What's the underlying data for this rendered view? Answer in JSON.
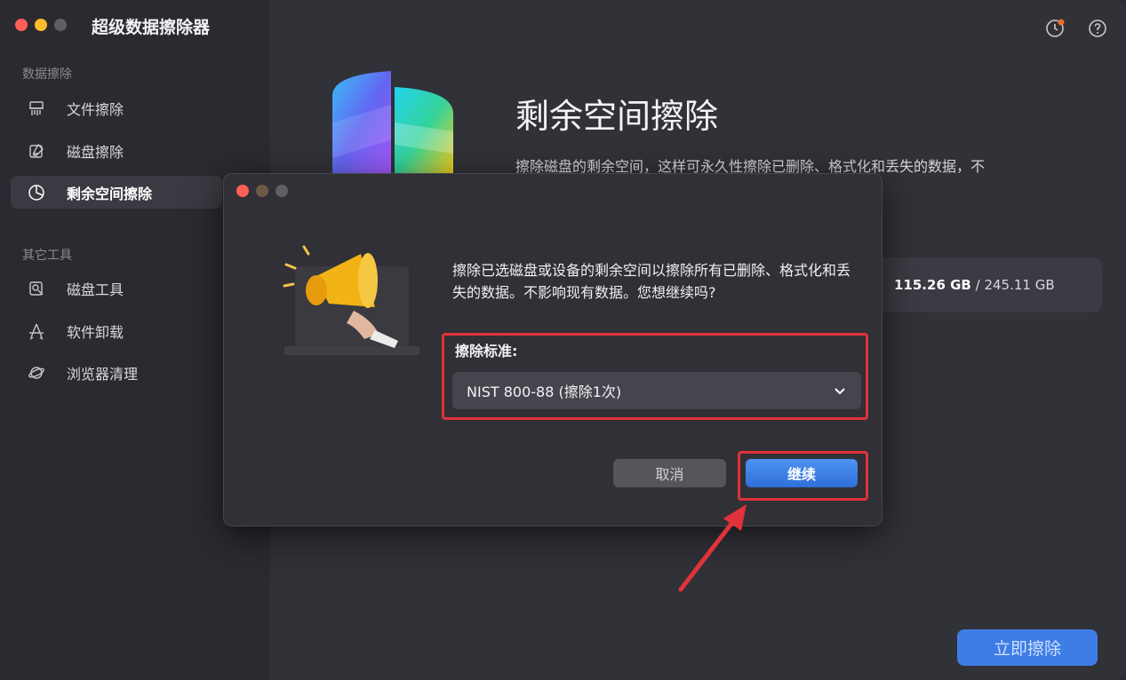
{
  "app": {
    "title": "超级数据擦除器"
  },
  "sidebar": {
    "section1": "数据擦除",
    "items1": [
      {
        "label": "文件擦除",
        "icon": "shredder-icon"
      },
      {
        "label": "磁盘擦除",
        "icon": "disk-edit-icon"
      },
      {
        "label": "剩余空间擦除",
        "icon": "pie-chart-icon",
        "active": true
      }
    ],
    "section2": "其它工具",
    "items2": [
      {
        "label": "磁盘工具",
        "icon": "disk-tool-icon"
      },
      {
        "label": "软件卸载",
        "icon": "app-uninstall-icon"
      },
      {
        "label": "浏览器清理",
        "icon": "browser-icon"
      }
    ]
  },
  "topbar": {
    "icons": [
      "history-icon",
      "help-icon"
    ]
  },
  "main": {
    "title": "剩余空间擦除",
    "description": "擦除磁盘的剩余空间，这样可永久性擦除已删除、格式化和丢失的数据，不",
    "disk": {
      "used": "115.26 GB",
      "separator": " / ",
      "total": "245.11 GB"
    },
    "erase_button": "立即擦除"
  },
  "dialog": {
    "message": "擦除已选磁盘或设备的剩余空间以擦除所有已删除、格式化和丢失的数据。不影响现有数据。您想继续吗?",
    "standard_label": "擦除标准:",
    "standard_value": "NIST 800-88 (擦除1次)",
    "cancel": "取消",
    "continue": "继续"
  },
  "colors": {
    "accent": "#3f7de6",
    "highlight": "#e2323a"
  }
}
